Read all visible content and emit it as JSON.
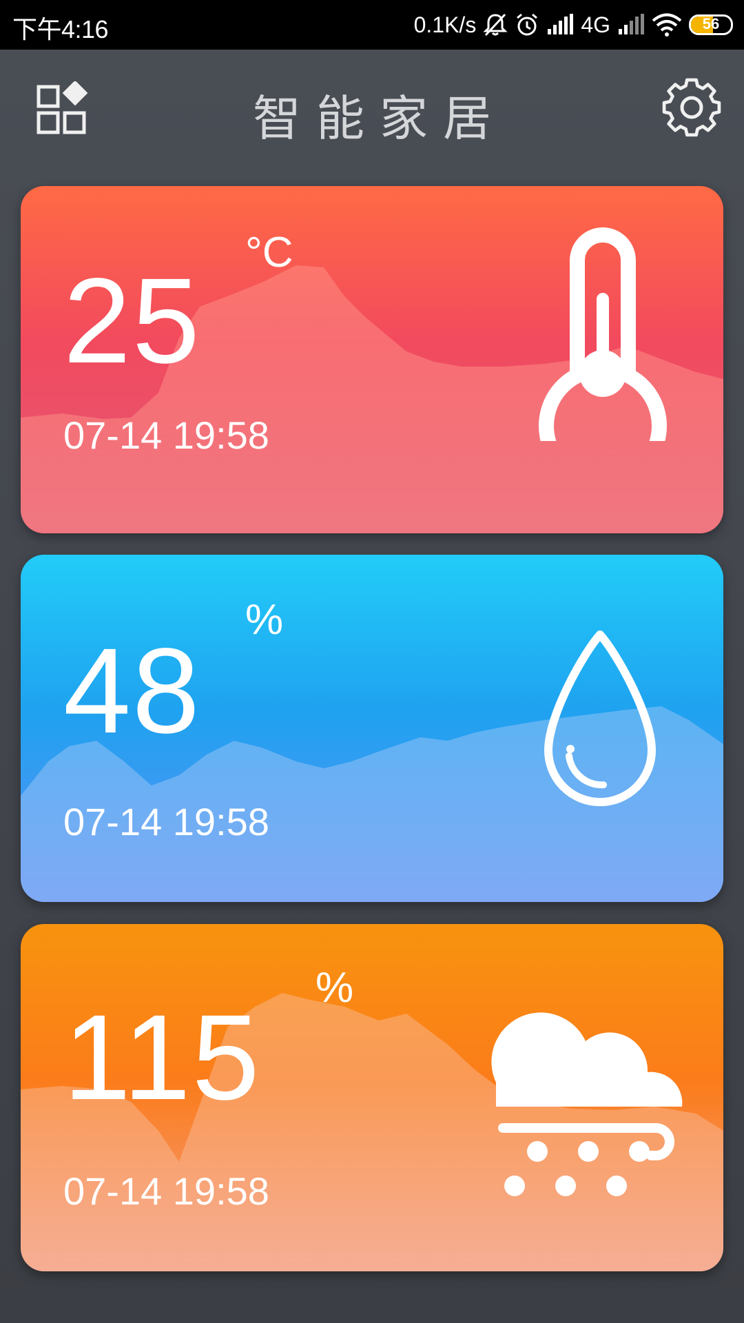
{
  "status_bar": {
    "time": "下午4:16",
    "net_speed": "0.1K/s",
    "network": "4G",
    "battery": "56",
    "battery_level": 0.56,
    "icons": [
      "mute-icon",
      "alarm-icon",
      "signal-icon",
      "signal-icon",
      "wifi-icon",
      "battery-icon"
    ]
  },
  "header": {
    "title": "智能家居",
    "left_icon": "apps-icon",
    "right_icon": "settings-icon"
  },
  "cards": [
    {
      "value": "25",
      "unit": "°C",
      "date": "07-14 19:58",
      "icon": "thermometer-icon",
      "colors": {
        "top": "#ff6a45",
        "bottom": "#e25a78"
      }
    },
    {
      "value": "48",
      "unit": "%",
      "date": "07-14 19:58",
      "icon": "water-drop-icon",
      "colors": {
        "top": "#22ccf8",
        "bottom": "#5e8ff4"
      }
    },
    {
      "value": "115",
      "unit": "%",
      "date": "07-14 19:58",
      "icon": "snow-cloud-icon",
      "colors": {
        "top": "#f8930e",
        "bottom": "#f3a08c"
      }
    }
  ]
}
